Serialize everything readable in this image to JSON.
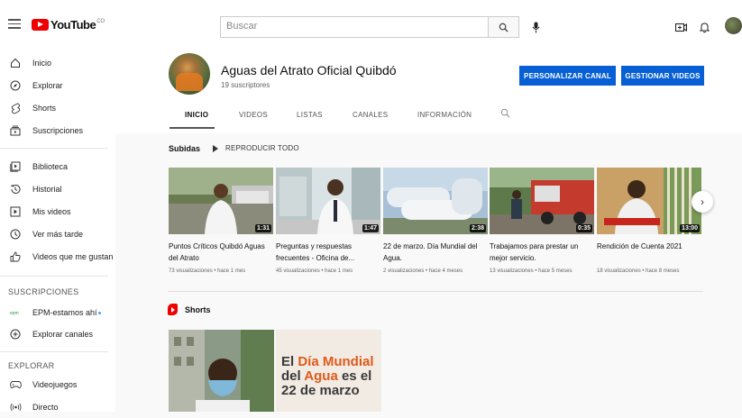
{
  "topbar": {
    "logo_text": "YouTube",
    "logo_country": "CO",
    "search_placeholder": "Buscar"
  },
  "sidebar": {
    "main": [
      {
        "label": "Inicio",
        "icon": "home-icon"
      },
      {
        "label": "Explorar",
        "icon": "compass-icon"
      },
      {
        "label": "Shorts",
        "icon": "shorts-icon"
      },
      {
        "label": "Suscripciones",
        "icon": "subscriptions-icon"
      }
    ],
    "library": [
      {
        "label": "Biblioteca",
        "icon": "library-icon"
      },
      {
        "label": "Historial",
        "icon": "history-icon"
      },
      {
        "label": "Mis videos",
        "icon": "my-videos-icon"
      },
      {
        "label": "Ver más tarde",
        "icon": "clock-icon"
      },
      {
        "label": "Videos que me gustan",
        "icon": "thumbs-up-icon"
      }
    ],
    "subscriptions_heading": "SUSCRIPCIONES",
    "subscriptions": [
      {
        "label": "EPM-estamos ahí",
        "icon": "epm-avatar-icon"
      },
      {
        "label": "Explorar canales",
        "icon": "plus-circle-icon"
      }
    ],
    "explore_heading": "EXPLORAR",
    "explore": [
      {
        "label": "Videojuegos",
        "icon": "gamepad-icon"
      },
      {
        "label": "Directo",
        "icon": "live-icon"
      }
    ]
  },
  "channel": {
    "name": "Aguas del Atrato Oficial Quibdó",
    "subscribers": "19 suscriptores",
    "customize_label": "PERSONALIZAR CANAL",
    "manage_label": "GESTIONAR VIDEOS",
    "tabs": [
      "INICIO",
      "VIDEOS",
      "LISTAS",
      "CANALES",
      "INFORMACIÓN"
    ]
  },
  "uploads": {
    "title": "Subidas",
    "play_all": "REPRODUCIR TODO",
    "videos": [
      {
        "title": "Puntos Críticos Quibdó Aguas del Atrato",
        "meta": "73 visualizaciones • hace 1 mes",
        "duration": "1:31"
      },
      {
        "title": "Preguntas y respuestas frecuentes - Oficina de...",
        "meta": "45 visualizaciones • hace 1 mes",
        "duration": "1:47"
      },
      {
        "title": "22 de marzo. Día Mundial del Agua.",
        "meta": "2 visualizaciones • hace 4 meses",
        "duration": "2:38"
      },
      {
        "title": "Trabajamos para prestar un mejor servicio.",
        "meta": "13 visualizaciones • hace 5 meses",
        "duration": "0:35"
      },
      {
        "title": "Rendición de Cuenta 2021",
        "meta": "18 visualizaciones • hace 8 meses",
        "duration": "13:00"
      }
    ]
  },
  "shorts": {
    "title": "Shorts",
    "short2_lines": [
      [
        {
          "t": "El ",
          "c": "dark"
        },
        {
          "t": "Día Mundial",
          "c": "orange"
        }
      ],
      [
        {
          "t": "del ",
          "c": "dark"
        },
        {
          "t": "Agua",
          "c": "orange"
        },
        {
          "t": " es el",
          "c": "dark"
        }
      ],
      [
        {
          "t": "22 de marzo",
          "c": "dark"
        }
      ]
    ]
  },
  "colors": {
    "accent_blue": "#065fd4",
    "youtube_red": "#ff0000"
  }
}
